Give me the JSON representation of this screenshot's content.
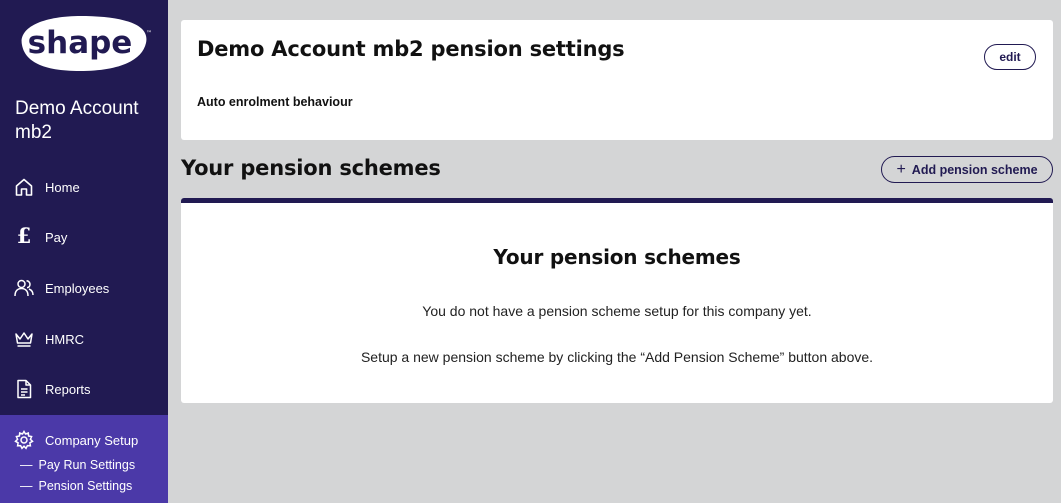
{
  "sidebar": {
    "logo_text": "shape",
    "company_name": "Demo Account mb2",
    "nav": [
      {
        "label": "Home",
        "icon": "home-icon"
      },
      {
        "label": "Pay",
        "icon": "pound-icon"
      },
      {
        "label": "Employees",
        "icon": "people-icon"
      },
      {
        "label": "HMRC",
        "icon": "crown-icon"
      },
      {
        "label": "Reports",
        "icon": "document-icon"
      },
      {
        "label": "Company Setup",
        "icon": "gear-icon"
      }
    ],
    "sub_items": [
      {
        "label": "Pay Run Settings"
      },
      {
        "label": "Pension Settings"
      }
    ],
    "sub_dash": "—"
  },
  "settings": {
    "title": "Demo Account mb2 pension settings",
    "subtitle": "Auto enrolment behaviour",
    "edit_label": "edit"
  },
  "schemes": {
    "section_title": "Your pension schemes",
    "add_label": "Add pension scheme",
    "card_heading": "Your pension schemes",
    "line1": "You do not have a pension scheme setup for this company yet.",
    "line2": "Setup a new pension scheme by clicking the “Add Pension Scheme” button above."
  },
  "colors": {
    "sidebar_bg": "#211a52",
    "sidebar_active": "#4b39a8",
    "page_bg": "#d4d5d6",
    "accent": "#211a52"
  }
}
